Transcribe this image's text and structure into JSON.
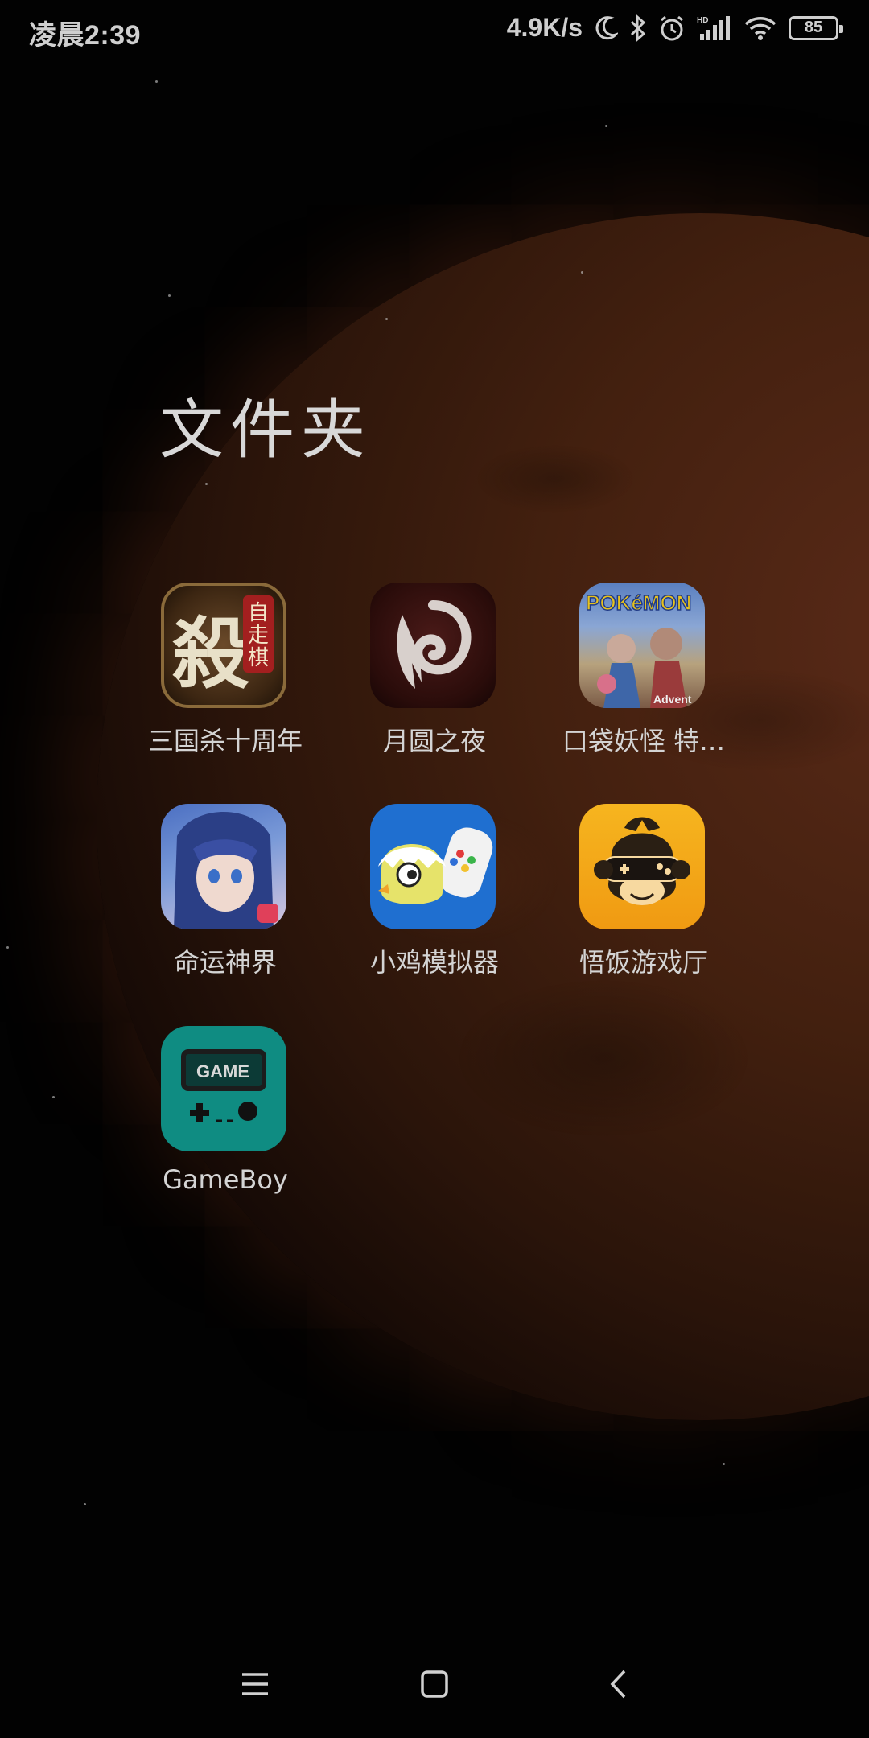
{
  "status_bar": {
    "time": "凌晨2:39",
    "network_speed": "4.9K/s",
    "battery_level": "85",
    "icons": [
      "moon-icon",
      "bluetooth-icon",
      "alarm-icon",
      "hd-signal-icon",
      "wifi-icon",
      "battery-icon"
    ]
  },
  "folder": {
    "title": "文件夹",
    "apps": [
      {
        "label": "三国杀十周年",
        "icon": "sanguosha-icon",
        "badge": "自走棋",
        "glyph": "殺"
      },
      {
        "label": "月圆之夜",
        "icon": "yueyuanzhiye-icon"
      },
      {
        "label": "口袋妖怪 特…",
        "icon": "pokemon-icon",
        "logo": "POKéMON",
        "sub": "Advent"
      },
      {
        "label": "命运神界",
        "icon": "mingyunshenjie-icon"
      },
      {
        "label": "小鸡模拟器",
        "icon": "xiaoji-emulator-icon"
      },
      {
        "label": "悟饭游戏厅",
        "icon": "wufan-icon"
      },
      {
        "label": "GameBoy",
        "icon": "gameboy-icon",
        "screen_text": "GAME"
      }
    ]
  },
  "nav": {
    "buttons": [
      "menu-icon",
      "home-icon",
      "back-icon"
    ]
  },
  "colors": {
    "text": "#d4d4d4",
    "status_text": "#cfcfcf",
    "gameboy_teal": "#0f8c82",
    "xiaoji_blue": "#1f6fd0",
    "wufan_orange": "#f2a516"
  }
}
